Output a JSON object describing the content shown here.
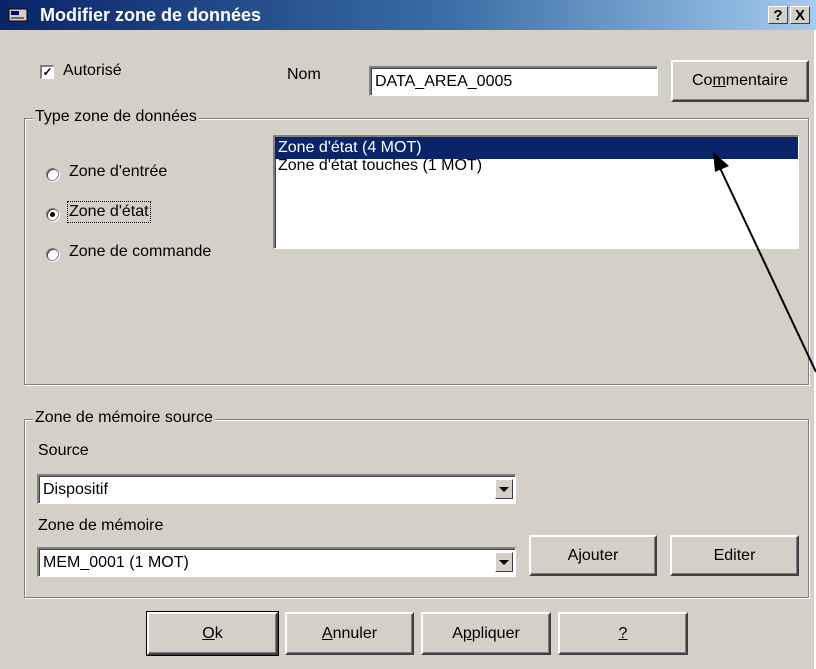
{
  "window": {
    "title": "Modifier zone de données",
    "help_glyph": "?",
    "close_glyph": "X",
    "icon": "window-app-icon"
  },
  "top": {
    "autorise_label": "Autorisé",
    "autorise_checked": true,
    "nom_label": "Nom",
    "nom_value": "DATA_AREA_0005",
    "commentaire_label": "Commentaire"
  },
  "type_group": {
    "legend": "Type zone de données",
    "radios": [
      "Zone d'entrée",
      "Zone d'état",
      "Zone de commande"
    ],
    "selected": "Zone d'état",
    "list_items": [
      "Zone d'état (4 MOT)",
      "Zone d'état touches (1 MOT)"
    ],
    "list_selected": "Zone d'état (4 MOT)"
  },
  "memory_group": {
    "legend": "Zone de mémoire source",
    "source_label": "Source",
    "source_value": "Dispositif",
    "zone_label": "Zone de mémoire",
    "zone_value": "MEM_0001 (1 MOT)",
    "ajouter_label": "Ajouter",
    "editer_label": "Editer"
  },
  "footer": {
    "ok_label": "Ok",
    "annuler_label": "Annuler",
    "appliquer_label": "Appliquer",
    "help_label": "?"
  }
}
